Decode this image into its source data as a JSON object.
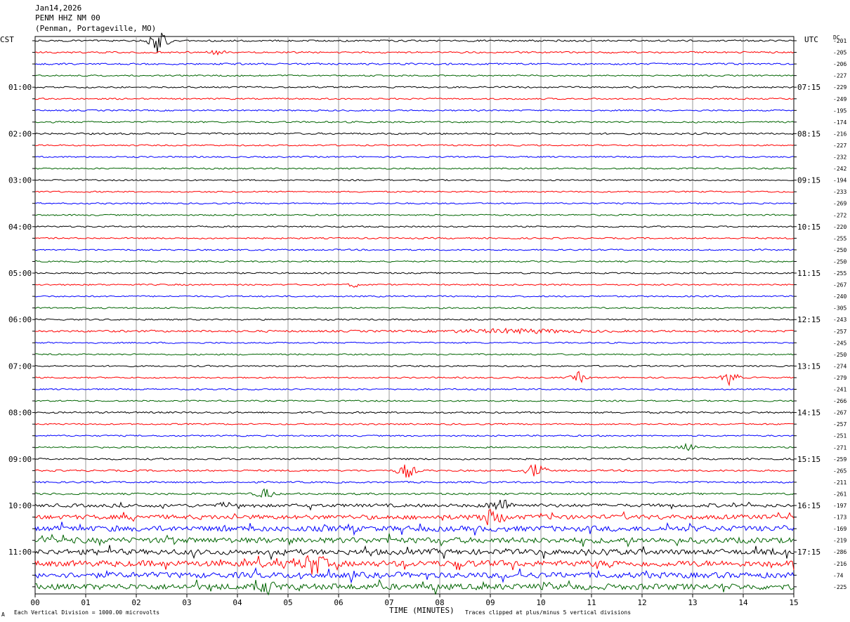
{
  "header": {
    "date": "Jan14,2026",
    "station": "PENM HHZ NM 00",
    "location": "(Penman, Portageville, MO)"
  },
  "left_zone_label": "CST",
  "right_zone_label": "UTC",
  "dc_label": "DC",
  "footer": {
    "scale_note": "Each Vertical Division = 1000.00 microvolts",
    "clip_note": "Traces clipped at plus/minus 5 vertical divisions",
    "corner_mark": "A"
  },
  "chart_data": {
    "type": "line",
    "xlabel": "TIME (MINUTES)",
    "x_ticks": [
      "00",
      "01",
      "02",
      "03",
      "04",
      "05",
      "06",
      "07",
      "08",
      "09",
      "10",
      "11",
      "12",
      "13",
      "14",
      "15"
    ],
    "xlim": [
      0,
      15
    ],
    "rows_per_hour": 4,
    "trace_colors": [
      "#000000",
      "#ff0000",
      "#0000ff",
      "#006400"
    ],
    "left_hour_labels": [
      "01:00",
      "02:00",
      "03:00",
      "04:00",
      "05:00",
      "06:00",
      "07:00",
      "08:00",
      "09:00",
      "10:00",
      "11:00"
    ],
    "right_hour_labels": [
      "07:15",
      "08:15",
      "09:15",
      "10:15",
      "11:15",
      "12:15",
      "13:15",
      "14:15",
      "15:15",
      "16:15",
      "17:15"
    ],
    "dc_offsets": [
      "-201",
      "-205",
      "-206",
      "-227",
      "-229",
      "-249",
      "-195",
      "-174",
      "-216",
      "-227",
      "-232",
      "-242",
      "-194",
      "-233",
      "-269",
      "-272",
      "-220",
      "-255",
      "-250",
      "-250",
      "-255",
      "-267",
      "-240",
      "-305",
      "-243",
      "-257",
      "-245",
      "-250",
      "-274",
      "-279",
      "-241",
      "-266",
      "-267",
      "-257",
      "-251",
      "-271",
      "-259",
      "-265",
      "-211",
      "-261",
      "-197",
      "-173",
      "-169",
      "-219",
      "-286",
      "-216",
      "-74",
      "-225"
    ],
    "events": [
      {
        "row": 0,
        "minute": 2.45,
        "amplitude": 22,
        "width": 0.35
      },
      {
        "row": 1,
        "minute": 3.6,
        "amplitude": 4,
        "width": 0.3
      },
      {
        "row": 21,
        "minute": 6.3,
        "amplitude": 4,
        "width": 0.2
      },
      {
        "row": 25,
        "minute": 9.5,
        "amplitude": 3,
        "width": 2.5
      },
      {
        "row": 29,
        "minute": 10.75,
        "amplitude": 8,
        "width": 0.3
      },
      {
        "row": 29,
        "minute": 13.75,
        "amplitude": 12,
        "width": 0.3
      },
      {
        "row": 35,
        "minute": 12.9,
        "amplitude": 7,
        "width": 0.3
      },
      {
        "row": 37,
        "minute": 7.35,
        "amplitude": 12,
        "width": 0.35
      },
      {
        "row": 37,
        "minute": 9.9,
        "amplitude": 13,
        "width": 0.35
      },
      {
        "row": 39,
        "minute": 4.55,
        "amplitude": 8,
        "width": 0.35
      },
      {
        "row": 40,
        "minute": 9.2,
        "amplitude": 9,
        "width": 0.5
      },
      {
        "row": 41,
        "minute": 9.0,
        "amplitude": 10,
        "width": 0.6
      },
      {
        "row": 45,
        "minute": 5.5,
        "amplitude": 18,
        "width": 0.4
      },
      {
        "row": 47,
        "minute": 4.6,
        "amplitude": 9,
        "width": 0.3
      }
    ],
    "noise_levels": [
      1.2,
      1.2,
      1.2,
      1.0,
      1.1,
      1.0,
      1.0,
      1.1,
      1.2,
      1.0,
      1.0,
      1.0,
      1.0,
      1.0,
      1.0,
      1.0,
      1.0,
      1.0,
      1.0,
      1.0,
      1.0,
      1.0,
      1.0,
      1.0,
      1.0,
      1.4,
      1.0,
      1.0,
      1.0,
      1.0,
      1.0,
      1.0,
      1.2,
      1.0,
      1.0,
      1.0,
      1.2,
      1.2,
      1.2,
      1.3,
      2.2,
      3.0,
      3.6,
      3.8,
      3.6,
      4.0,
      3.8,
      4.0
    ]
  }
}
